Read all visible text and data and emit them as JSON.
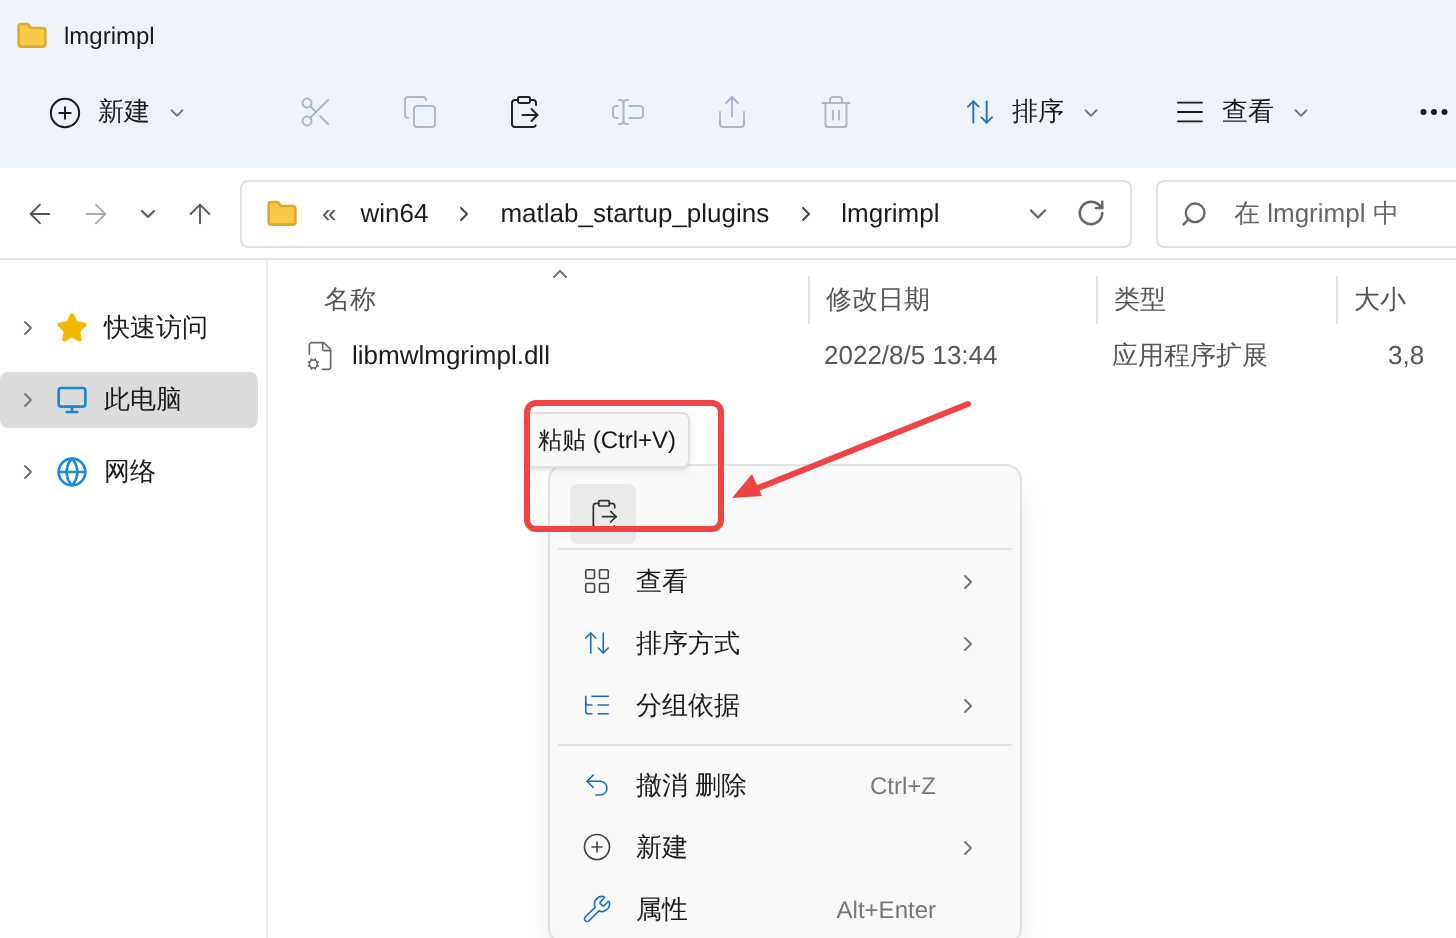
{
  "window": {
    "title": "lmgrimpl"
  },
  "toolbar": {
    "new_button": {
      "label": "新建"
    },
    "actions": [
      {
        "disabled": true
      },
      {
        "disabled": true
      },
      {
        "disabled": false
      },
      {
        "disabled": true
      },
      {
        "disabled": true
      },
      {
        "disabled": true
      }
    ],
    "sort_button": {
      "label": "排序"
    },
    "view_button": {
      "label": "查看"
    }
  },
  "address_bar": {
    "overflow": "«",
    "segments": [
      "win64",
      "matlab_startup_plugins",
      "lmgrimpl"
    ]
  },
  "search": {
    "placeholder": "在 lmgrimpl 中"
  },
  "sidebar": {
    "items": [
      {
        "label": "快速访问",
        "selected": false
      },
      {
        "label": "此电脑",
        "selected": true
      },
      {
        "label": "网络",
        "selected": false
      }
    ]
  },
  "table": {
    "columns": [
      "名称",
      "修改日期",
      "类型",
      "大小"
    ],
    "rows": [
      {
        "name": "libmwlmgrimpl.dll",
        "modified": "2022/8/5 13:44",
        "type": "应用程序扩展",
        "size": "3,8"
      }
    ]
  },
  "tooltip": {
    "text": "粘贴 (Ctrl+V)"
  },
  "context_menu": {
    "items": [
      {
        "label": "查看",
        "submenu": true
      },
      {
        "label": "排序方式",
        "submenu": true
      },
      {
        "label": "分组依据",
        "submenu": true
      },
      {
        "label": "撤消 删除",
        "shortcut": "Ctrl+Z",
        "submenu": false
      },
      {
        "label": "新建",
        "submenu": true
      },
      {
        "label": "属性",
        "shortcut": "Alt+Enter",
        "submenu": false
      }
    ]
  }
}
